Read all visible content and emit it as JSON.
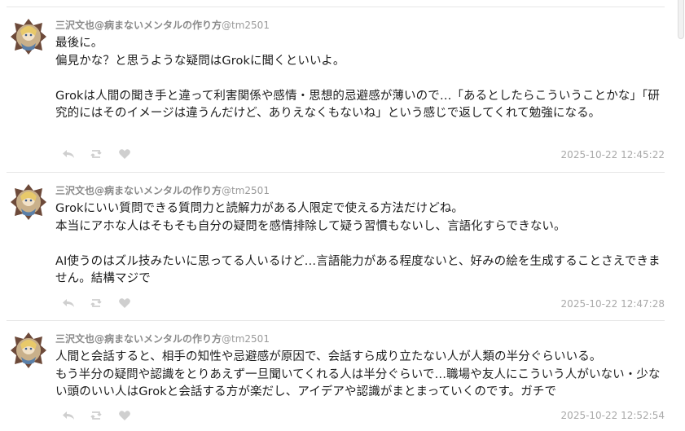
{
  "tweets": [
    {
      "author_name": "三沢文也@病まないメンタルの作り方",
      "handle": "@tm2501",
      "text": "最後に。\n偏見かな？と思うような疑問はGrokに聞くといいよ。\n\nGrokは人間の聞き手と違って利害関係や感情・思想的忌避感が薄いので…「あるとしたらこういうことかな」「研究的にはそのイメージは違うんだけど、ありえなくもないね」という感じで返してくれて勉強になる。",
      "timestamp": "2025-10-22 12:45:22"
    },
    {
      "author_name": "三沢文也@病まないメンタルの作り方",
      "handle": "@tm2501",
      "text": "Grokにいい質問できる質問力と読解力がある人限定で使える方法だけどね。\n本当にアホな人はそもそも自分の疑問を感情排除して疑う習慣もないし、言語化すらできない。\n\nAI使うのはズル技みたいに思ってる人いるけど…言語能力がある程度ないと、好みの絵を生成することさえできません。結構マジで",
      "timestamp": "2025-10-22 12:47:28"
    },
    {
      "author_name": "三沢文也@病まないメンタルの作り方",
      "handle": "@tm2501",
      "text": "人間と会話すると、相手の知性や忌避感が原因で、会話すら成り立たない人が人類の半分ぐらいいる。\nもう半分の疑問や認識をとりあえず一旦聞いてくれる人は半分ぐらいで…職場や友人にこういう人がいない・少ない頭のいい人はGrokと会話する方が楽だし、アイデアや認識がまとまっていくのです。ガチで",
      "timestamp": "2025-10-22 12:52:54"
    }
  ],
  "icons": {
    "reply": "reply-icon",
    "retweet": "retweet-icon",
    "like": "heart-icon"
  },
  "colors": {
    "meta_text": "#8a8a8a",
    "icon": "#cfcfcf",
    "divider": "#e6e6e6"
  }
}
